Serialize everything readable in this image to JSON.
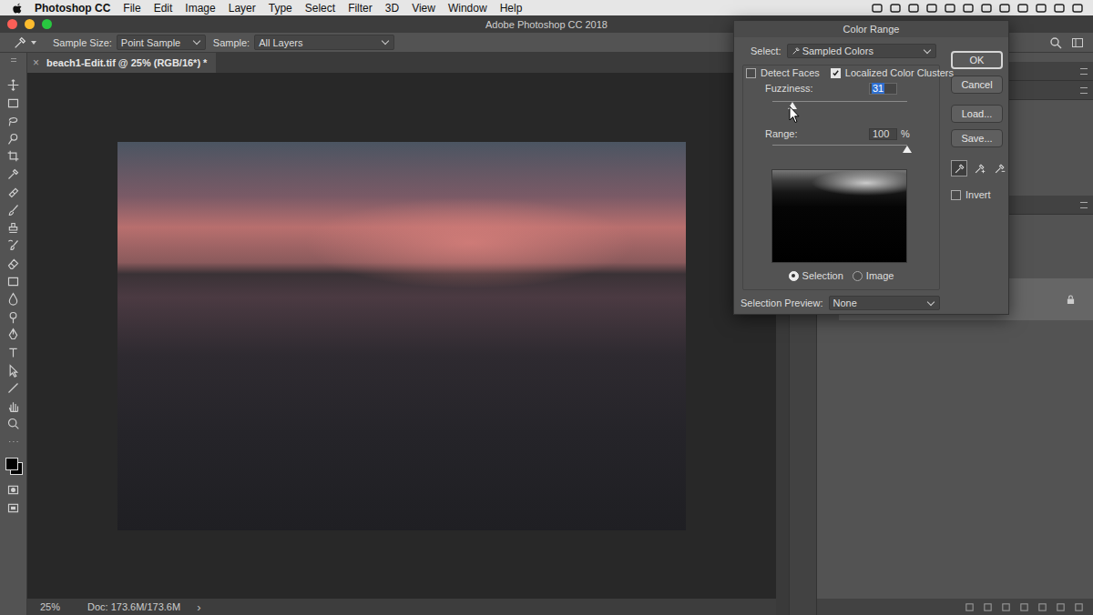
{
  "menubar": {
    "app": "Photoshop CC",
    "items": [
      "File",
      "Edit",
      "Image",
      "Layer",
      "Type",
      "Select",
      "Filter",
      "3D",
      "View",
      "Window",
      "Help"
    ]
  },
  "window": {
    "title": "Adobe Photoshop CC 2018"
  },
  "options_bar": {
    "sample_size_label": "Sample Size:",
    "sample_size": "Point Sample",
    "sample_label": "Sample:",
    "sample": "All Layers"
  },
  "document_tab": {
    "title": "beach1-Edit.tif @ 25% (RGB/16*) *",
    "close": "×"
  },
  "status_bar": {
    "zoom": "25%",
    "doc": "Doc: 173.6M/173.6M",
    "arrow": "›"
  },
  "dialog": {
    "title": "Color Range",
    "select_label": "Select:",
    "select_value": "Sampled Colors",
    "checkboxes": [
      {
        "label": "Detect Faces",
        "checked": false
      },
      {
        "label": "Localized Color Clusters",
        "checked": true
      }
    ],
    "sliders": [
      {
        "label": "Fuzziness:",
        "value": "31",
        "level": 0.15,
        "focused": true
      },
      {
        "label": "Range:",
        "value": "100",
        "unit": "%",
        "level": 1,
        "focused": false
      }
    ],
    "view_options": [
      {
        "label": "Selection",
        "selected": true
      },
      {
        "label": "Image",
        "selected": false
      }
    ],
    "preview_label": "Selection Preview:",
    "preview_value": "None",
    "buttons": [
      "OK",
      "Cancel",
      "Load...",
      "Save..."
    ],
    "eyedroppers": [
      {
        "kind": "sample",
        "selected": true
      },
      {
        "kind": "add",
        "selected": false
      },
      {
        "kind": "subtract",
        "selected": false
      }
    ],
    "invert": {
      "label": "Invert",
      "checked": false
    }
  }
}
